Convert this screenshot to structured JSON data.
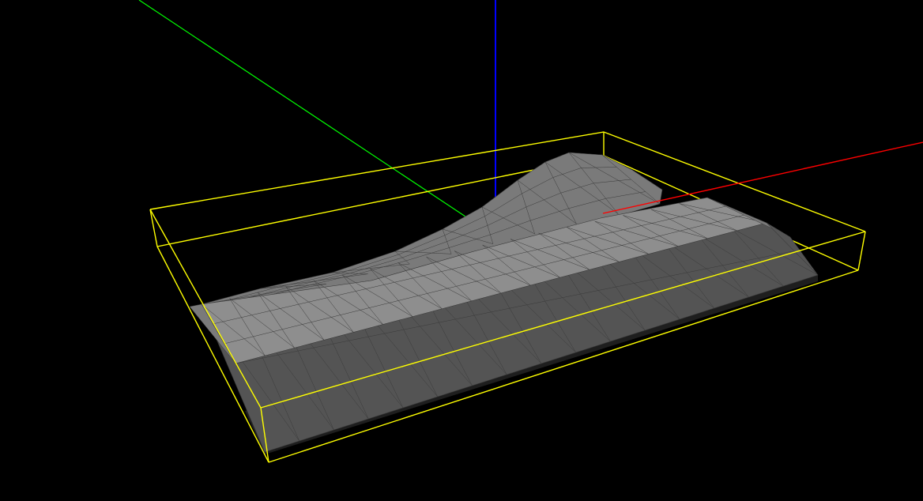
{
  "viewport": {
    "background": "#000000",
    "axes": {
      "x_color": "#ff0000",
      "y_color": "#00ff00",
      "z_color": "#0000ff"
    },
    "bounding_box_color": "#ffff00",
    "mesh": {
      "top_face_color": "#8e8e8e",
      "side_face_color": "#545454",
      "ramp_face_color": "#7a7a7a",
      "edge_color": "#3a3a3a",
      "shadow_color": "#1e1e1e"
    }
  }
}
